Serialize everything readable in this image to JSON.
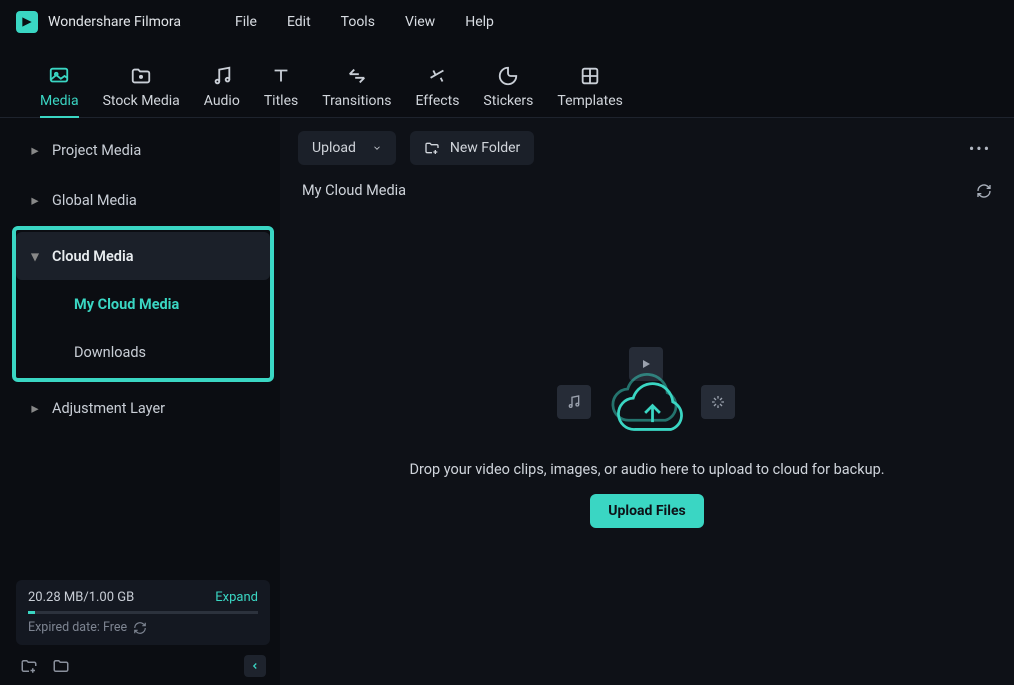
{
  "app": {
    "name": "Wondershare Filmora"
  },
  "menubar": [
    "File",
    "Edit",
    "Tools",
    "View",
    "Help"
  ],
  "tabs": [
    {
      "label": "Media",
      "icon": "image-icon",
      "active": true
    },
    {
      "label": "Stock Media",
      "icon": "folder-icon"
    },
    {
      "label": "Audio",
      "icon": "music-icon"
    },
    {
      "label": "Titles",
      "icon": "text-icon"
    },
    {
      "label": "Transitions",
      "icon": "swap-icon"
    },
    {
      "label": "Effects",
      "icon": "sparkle-icon"
    },
    {
      "label": "Stickers",
      "icon": "sticker-icon"
    },
    {
      "label": "Templates",
      "icon": "grid-icon"
    }
  ],
  "sidebar": {
    "items": {
      "project_media": "Project Media",
      "global_media": "Global Media",
      "cloud_media": "Cloud Media",
      "my_cloud_media": "My Cloud Media",
      "downloads": "Downloads",
      "adjustment_layer": "Adjustment Layer"
    },
    "storage": {
      "usage": "20.28 MB/1.00 GB",
      "expand": "Expand",
      "expired": "Expired date: Free"
    }
  },
  "content": {
    "upload_label": "Upload",
    "new_folder_label": "New Folder",
    "panel_title": "My Cloud Media",
    "drop_text": "Drop your video clips, images, or audio here to upload to cloud for backup.",
    "upload_files": "Upload Files"
  }
}
